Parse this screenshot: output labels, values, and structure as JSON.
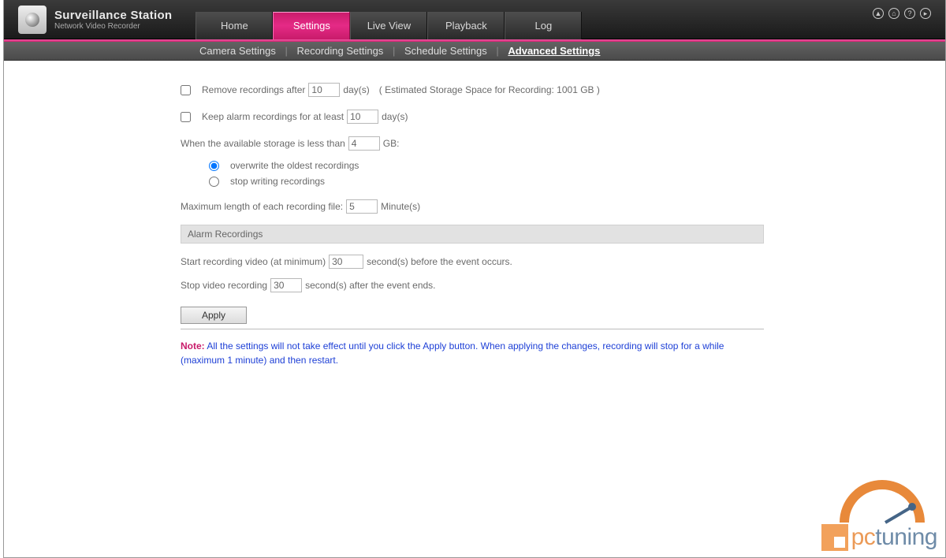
{
  "header": {
    "title": "Surveillance Station",
    "subtitle": "Network Video Recorder",
    "tabs": [
      "Home",
      "Settings",
      "Live View",
      "Playback",
      "Log"
    ],
    "active_tab": "Settings",
    "subtabs": [
      "Camera Settings",
      "Recording Settings",
      "Schedule Settings",
      "Advanced Settings"
    ],
    "active_subtab": "Advanced Settings"
  },
  "settings": {
    "remove_label_pre": "Remove recordings after",
    "remove_value": "10",
    "remove_label_post": "day(s)",
    "storage_estimate": "( Estimated Storage Space for Recording:  1001 GB )",
    "keep_label_pre": "Keep alarm recordings for at least",
    "keep_value": "10",
    "keep_label_post": "day(s)",
    "avail_label_pre": "When the available storage is less than",
    "avail_value": "4",
    "avail_label_post": "GB:",
    "radio_overwrite": "overwrite the oldest recordings",
    "radio_stop": "stop writing recordings",
    "maxlen_label_pre": "Maximum length of each recording file:",
    "maxlen_value": "5",
    "maxlen_label_post": "Minute(s)"
  },
  "alarm": {
    "section_title": "Alarm Recordings",
    "start_pre": "Start recording video (at minimum)",
    "start_value": "30",
    "start_post": "second(s) before the event occurs.",
    "stop_pre": "Stop video recording",
    "stop_value": "30",
    "stop_post": "second(s) after the event ends."
  },
  "apply_label": "Apply",
  "note_label": "Note:",
  "note_text": "All the settings will not take effect until you click the Apply button. When applying the changes, recording will stop for a while (maximum 1 minute) and then restart.",
  "watermark": {
    "text_orange": "pc",
    "text_blue": "tuning"
  }
}
